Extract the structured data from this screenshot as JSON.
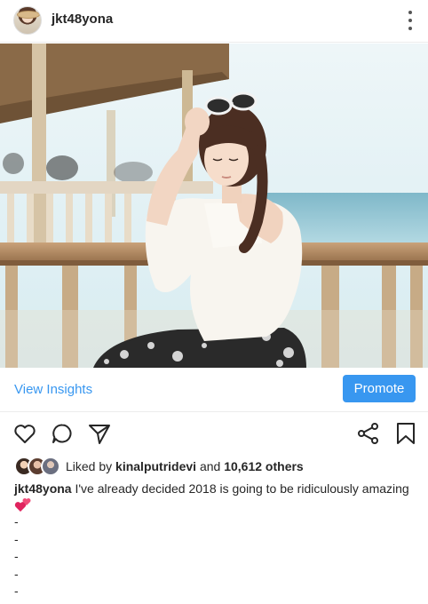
{
  "header": {
    "username": "jkt48yona",
    "more_icon": "more-vertical-icon"
  },
  "post": {
    "image_alt": "girl-with-sunglasses-photo"
  },
  "insights_bar": {
    "view_insights_label": "View Insights",
    "promote_label": "Promote"
  },
  "actions": {
    "icons": [
      "heart-icon",
      "comment-icon",
      "share-icon",
      "share-nodes-icon",
      "bookmark-icon"
    ]
  },
  "likes": {
    "prefix": "Liked by ",
    "liker": "kinalputridevi",
    "connector": " and ",
    "others": "10,612 others"
  },
  "caption": {
    "author": "jkt48yona",
    "text": " I've already decided 2018 is going to be ridiculously amazing",
    "emoji": "two-hearts-emoji",
    "dash_lines": [
      "-",
      "-",
      "-",
      "-",
      "-"
    ]
  },
  "colors": {
    "accent": "#3897f0",
    "text": "#262626"
  }
}
